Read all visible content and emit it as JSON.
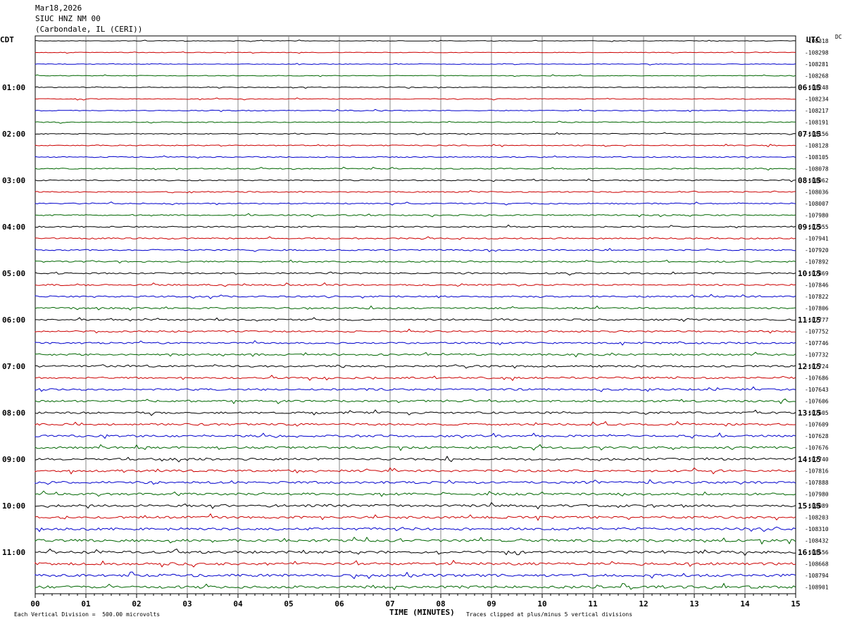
{
  "header": {
    "date": "Mar18,2026",
    "station": "SIUC HNZ NM 00",
    "location": "(Carbondale, IL (CERI))"
  },
  "chart_data": {
    "type": "line",
    "title": "",
    "xlabel": "TIME (MINUTES)",
    "x_ticks": [
      "00",
      "01",
      "02",
      "03",
      "04",
      "05",
      "06",
      "07",
      "08",
      "09",
      "10",
      "11",
      "12",
      "13",
      "14",
      "15"
    ],
    "xlim": [
      0,
      15
    ],
    "left_timezone": "CDT",
    "right_timezone": "UTC",
    "dc_label": "DC",
    "left_hour_labels": [
      "01:00",
      "02:00",
      "03:00",
      "04:00",
      "05:00",
      "06:00",
      "07:00",
      "08:00",
      "09:00",
      "10:00",
      "11:00"
    ],
    "right_hour_labels": [
      "06:15",
      "07:15",
      "08:15",
      "09:15",
      "10:15",
      "11:15",
      "12:15",
      "13:15",
      "14:15",
      "15:15",
      "16:15"
    ],
    "trace_colors": [
      "#000000",
      "#cc0000",
      "#0000cc",
      "#006600"
    ],
    "dc_offsets": [
      "-108318",
      "-108298",
      "-108281",
      "-108268",
      "-108248",
      "-108234",
      "-108217",
      "-108191",
      "-108156",
      "-108128",
      "-108105",
      "-108078",
      "-108062",
      "-108036",
      "-108007",
      "-107980",
      "-107955",
      "-107941",
      "-107920",
      "-107892",
      "-107869",
      "-107846",
      "-107822",
      "-107806",
      "-107777",
      "-107752",
      "-107746",
      "-107732",
      "-107724",
      "-107686",
      "-107643",
      "-107606",
      "-107605",
      "-107609",
      "-107628",
      "-107676",
      "-107740",
      "-107816",
      "-107888",
      "-107980",
      "-108089",
      "-108203",
      "-108310",
      "-108432",
      "-108556",
      "-108668",
      "-108794",
      "-108901"
    ],
    "grid": true
  },
  "footer": {
    "scale_note": "Each Vertical Division =  500.00 microvolts",
    "clip_note": "Traces clipped at plus/minus 5 vertical divisions"
  }
}
